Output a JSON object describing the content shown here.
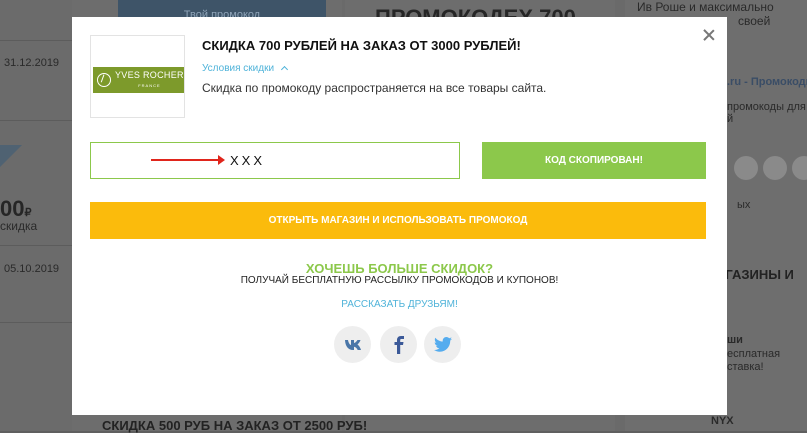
{
  "background": {
    "promo_button": "Твой промокод",
    "date_1": "31.12.2019",
    "date_2": "05.10.2019",
    "amount": "00",
    "currency": "₽",
    "amount_label": "скидка",
    "heading_top": "ПРОМОКОДЕХ 700",
    "heading_bottom": "СКИДКА 500 РУБ НА ЗАКАЗ ОТ 2500 РУБ!",
    "right_top_1": "Ив Роше и максимально",
    "right_top_2": "своей",
    "right_link": ".ru - Промокоды",
    "right_small_1": "промокоды для",
    "right_small_2": "й",
    "right_label_1": "ых",
    "right_heading": "АГАЗИНЫ И",
    "right_list_1": "ши",
    "right_list_2": "есплатная",
    "right_list_3": "ставка!",
    "right_bottom": "NYX"
  },
  "modal": {
    "logo_text": "YVES ROCHER",
    "logo_sub": "FRANCE",
    "title": "СКИДКА 700 РУБЛЕЙ НА ЗАКАЗ ОТ 3000 РУБЛЕЙ!",
    "conditions_link": "Условия скидки",
    "description": "Скидка по промокоду распространяется на все товары сайта.",
    "code_value": "XXX",
    "copied_button": "КОД СКОПИРОВАН!",
    "open_shop_button": "ОТКРЫТЬ МАГАЗИН И ИСПОЛЬЗОВАТЬ ПРОМОКОД",
    "promo_heading": "ХОЧЕШЬ БОЛЬШЕ СКИДОК?",
    "promo_subtext": "ПОЛУЧАЙ БЕСПЛАТНУЮ РАССЫЛКУ ПРОМОКОДОВ И КУПОНОВ!",
    "share_link": "РАССКАЗАТЬ ДРУЗЬЯМ!",
    "social": [
      {
        "icon": "vk-icon",
        "glyph": "ВК",
        "color": "#4a76a8"
      },
      {
        "icon": "facebook-icon",
        "glyph": "f",
        "color": "#3b5998"
      },
      {
        "icon": "twitter-icon",
        "glyph": "t",
        "color": "#55acee"
      }
    ]
  },
  "colors": {
    "green": "#8cc84b",
    "yellow": "#fbbb0c",
    "link_blue": "#4fb3d9",
    "logo_green": "#7d9a2b",
    "arrow_red": "#e0251c"
  }
}
